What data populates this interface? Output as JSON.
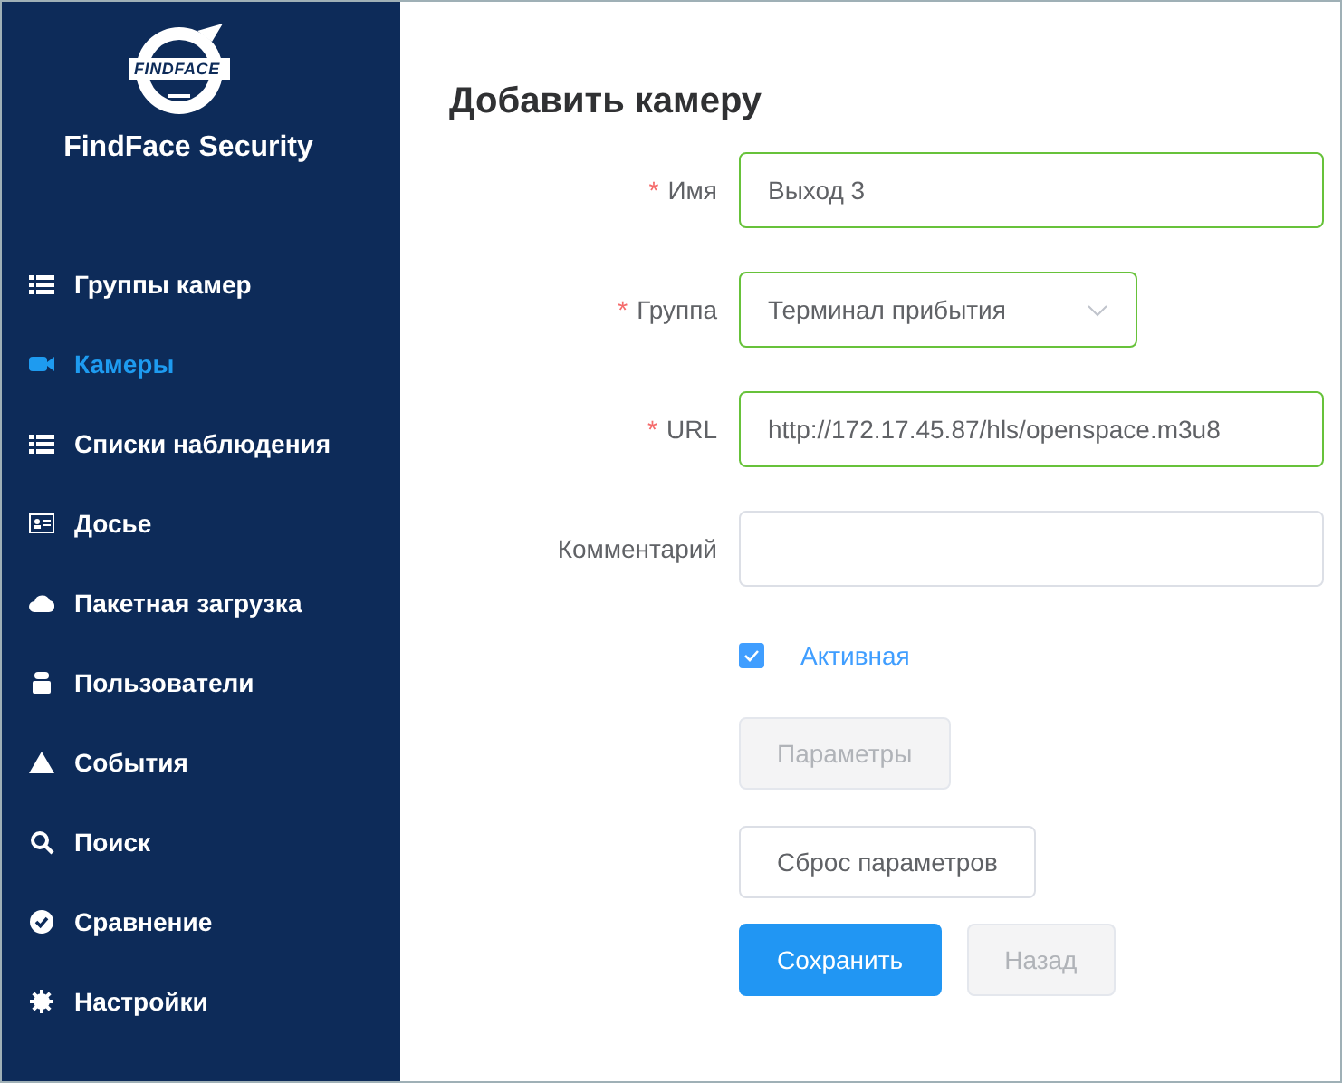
{
  "sidebar": {
    "logo_text": "FINDFACE",
    "app_title": "FindFace Security",
    "items": [
      {
        "label": "Группы камер",
        "selected": false
      },
      {
        "label": "Камеры",
        "selected": true
      },
      {
        "label": "Списки наблюдения",
        "selected": false
      },
      {
        "label": "Досье",
        "selected": false
      },
      {
        "label": "Пакетная загрузка",
        "selected": false
      },
      {
        "label": "Пользователи",
        "selected": false
      },
      {
        "label": "События",
        "selected": false
      },
      {
        "label": "Поиск",
        "selected": false
      },
      {
        "label": "Сравнение",
        "selected": false
      },
      {
        "label": "Настройки",
        "selected": false
      }
    ]
  },
  "form": {
    "title": "Добавить камеру",
    "fields": [
      {
        "kind": "input",
        "required_mark": "*",
        "label": "Имя",
        "valid": true,
        "value": "Выход 3"
      },
      {
        "kind": "select",
        "required_mark": "*",
        "label": "Группа",
        "valid": true,
        "value": "Терминал прибытия"
      },
      {
        "kind": "input",
        "required_mark": "*",
        "label": "URL",
        "valid": true,
        "value": "http://172.17.45.87/hls/openspace.m3u8"
      },
      {
        "kind": "input",
        "label": "Комментарий",
        "valid": false
      }
    ],
    "active": {
      "label": "Активная",
      "checked": true
    },
    "buttons": [
      {
        "label": "Параметры",
        "kind": "default",
        "disabled": true
      },
      {
        "label": "Сброс параметров",
        "kind": "default",
        "disabled": false
      }
    ],
    "actions": [
      {
        "label": "Сохранить",
        "kind": "primary",
        "disabled": false
      },
      {
        "label": "Назад",
        "kind": "default",
        "disabled": true
      }
    ]
  }
}
